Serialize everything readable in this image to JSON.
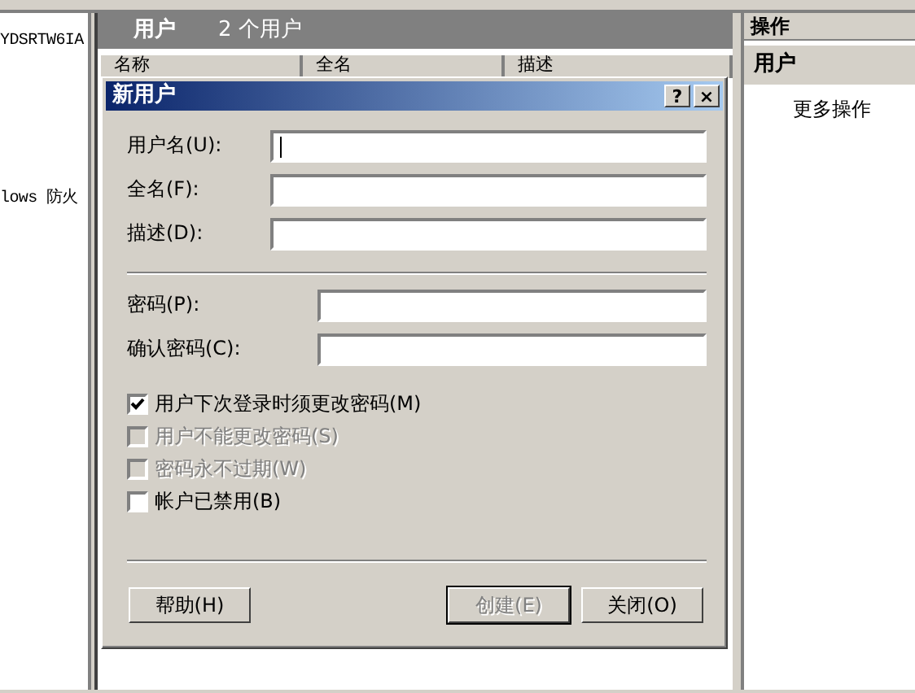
{
  "left_pane": {
    "lines": [
      "YDSRTW6IA",
      "lows 防火"
    ]
  },
  "center": {
    "header": {
      "title": "用户",
      "count": "2 个用户"
    },
    "columns": [
      "名称",
      "全名",
      "描述"
    ]
  },
  "actions_pane": {
    "title": "操作",
    "section": "用户",
    "items": [
      "更多操作"
    ]
  },
  "dialog": {
    "title": "新用户",
    "title_buttons": [
      "?",
      "×"
    ],
    "fields": [
      {
        "label": "用户名(U):",
        "focused": true
      },
      {
        "label": "全名(F):",
        "focused": false
      },
      {
        "label": "描述(D):",
        "focused": false
      }
    ],
    "password_fields": [
      {
        "label": "密码(P):"
      },
      {
        "label": "确认密码(C):"
      }
    ],
    "checkboxes": [
      {
        "label": "用户下次登录时须更改密码(M)",
        "checked": true,
        "disabled": false
      },
      {
        "label": "用户不能更改密码(S)",
        "checked": false,
        "disabled": true
      },
      {
        "label": "密码永不过期(W)",
        "checked": false,
        "disabled": true
      },
      {
        "label": "帐户已禁用(B)",
        "checked": false,
        "disabled": false
      }
    ],
    "buttons": [
      {
        "label": "帮助(H)",
        "disabled": false,
        "default": false
      },
      {
        "label": "创建(E)",
        "disabled": true,
        "default": true
      },
      {
        "label": "关闭(O)",
        "disabled": false,
        "default": false
      }
    ]
  }
}
